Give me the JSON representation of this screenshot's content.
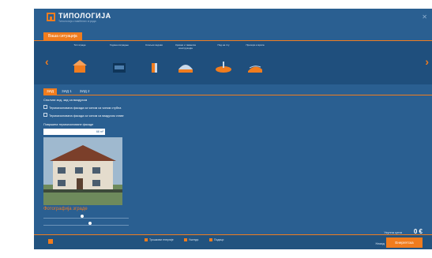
{
  "app": {
    "title": "ТИПОЛОГИЈА",
    "subtitle": "Типологија стамбених зграда"
  },
  "tabs": [
    "Ваша ситуација"
  ],
  "carousel": {
    "items": [
      {
        "label": "Тип зграде",
        "icon": "house-icon"
      },
      {
        "label": "Година изградње",
        "icon": "calendar-icon"
      },
      {
        "label": "Спољни зидови",
        "icon": "wall-icon"
      },
      {
        "label": "Кровни и таванска конструкција",
        "icon": "roof-icon"
      },
      {
        "label": "Под на тлу",
        "icon": "floor-icon"
      },
      {
        "label": "Прозори и врата",
        "icon": "window-icon"
      }
    ]
  },
  "subtabs": [
    "ЗИД",
    "ЗИД 1",
    "ЗИД 2"
  ],
  "content": {
    "heading": "Спољни зид, зид са ваздухом",
    "options": [
      "Термоизолована фасада са чином са чином стубна",
      "Термоизолована фасада са чином са ваздухом ставе"
    ],
    "area_label": "Површина термоизоловане фасаде",
    "area_value": "68 m²",
    "photo_caption": "Фотографија зграде",
    "sliders": [
      0.45,
      0.55
    ]
  },
  "footer": {
    "legend": [
      "Трошкови енергије",
      "Уштеда",
      "Подаци"
    ],
    "price_label": "Укупна цена",
    "price_value": "0 €",
    "back_label": "Назад",
    "next_label": "Енергетска"
  },
  "colors": {
    "accent": "#f07c1e",
    "background": "#2a5f91"
  }
}
